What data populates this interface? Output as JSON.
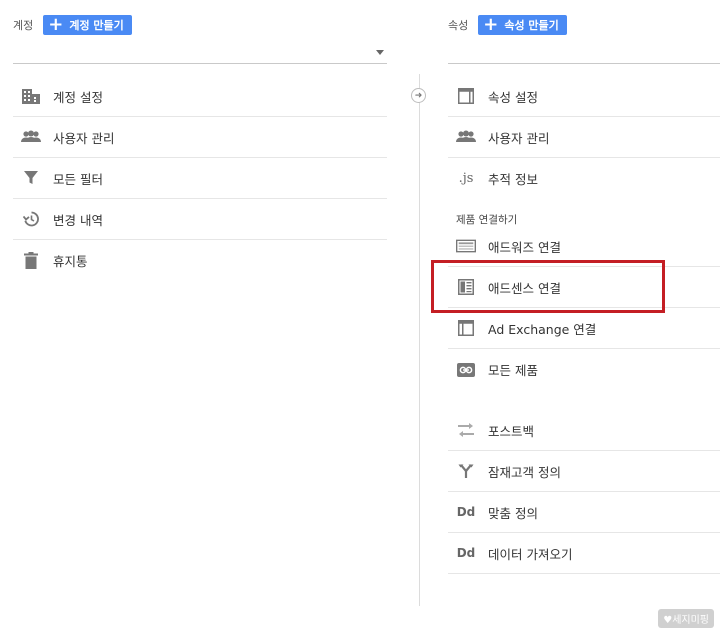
{
  "account": {
    "label": "계정",
    "create_button": "계정 만들기",
    "menu": [
      {
        "icon": "building-icon",
        "label": "계정 설정"
      },
      {
        "icon": "users-icon",
        "label": "사용자 관리"
      },
      {
        "icon": "filter-icon",
        "label": "모든 필터"
      },
      {
        "icon": "history-icon",
        "label": "변경 내역"
      },
      {
        "icon": "trash-icon",
        "label": "휴지통"
      }
    ]
  },
  "property": {
    "label": "속성",
    "create_button": "속성 만들기",
    "menu": [
      {
        "icon": "property-window-icon",
        "label": "속성 설정"
      },
      {
        "icon": "users-icon",
        "label": "사용자 관리"
      },
      {
        "icon": "js-icon",
        "label": "추적 정보"
      }
    ],
    "section_label": "제품 연결하기",
    "links": [
      {
        "icon": "adwords-icon",
        "label": "애드워즈 연결"
      },
      {
        "icon": "adsense-icon",
        "label": "애드센스 연결"
      },
      {
        "icon": "adexchange-icon",
        "label": "Ad Exchange 연결"
      },
      {
        "icon": "link-icon",
        "label": "모든 제품"
      }
    ],
    "more": [
      {
        "icon": "postback-icon",
        "label": "포스트백"
      },
      {
        "icon": "audience-icon",
        "label": "잠재고객 정의"
      },
      {
        "icon": "dd-icon",
        "label": "맞춤 정의"
      },
      {
        "icon": "dd-icon",
        "label": "데이터 가져오기"
      }
    ],
    "icon_text": {
      "js": ".js",
      "dd": "Dd"
    }
  },
  "watermark": "♥세지미핑"
}
